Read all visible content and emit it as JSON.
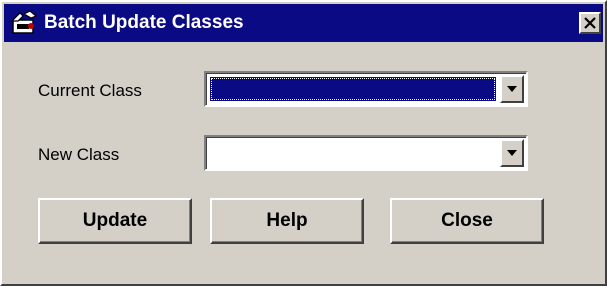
{
  "window": {
    "title": "Batch Update Classes",
    "icon": "batch-update-icon",
    "close_icon": "close-icon",
    "title_bar_color": "#0a0a84",
    "face_color": "#d4d0c8"
  },
  "form": {
    "current_class": {
      "label": "Current Class",
      "value": "",
      "state": "focused-selected",
      "arrow_icon": "chevron-down-icon"
    },
    "new_class": {
      "label": "New Class",
      "value": "",
      "arrow_icon": "chevron-down-icon"
    }
  },
  "buttons": {
    "update_label": "Update",
    "help_label": "Help",
    "close_label": "Close"
  }
}
